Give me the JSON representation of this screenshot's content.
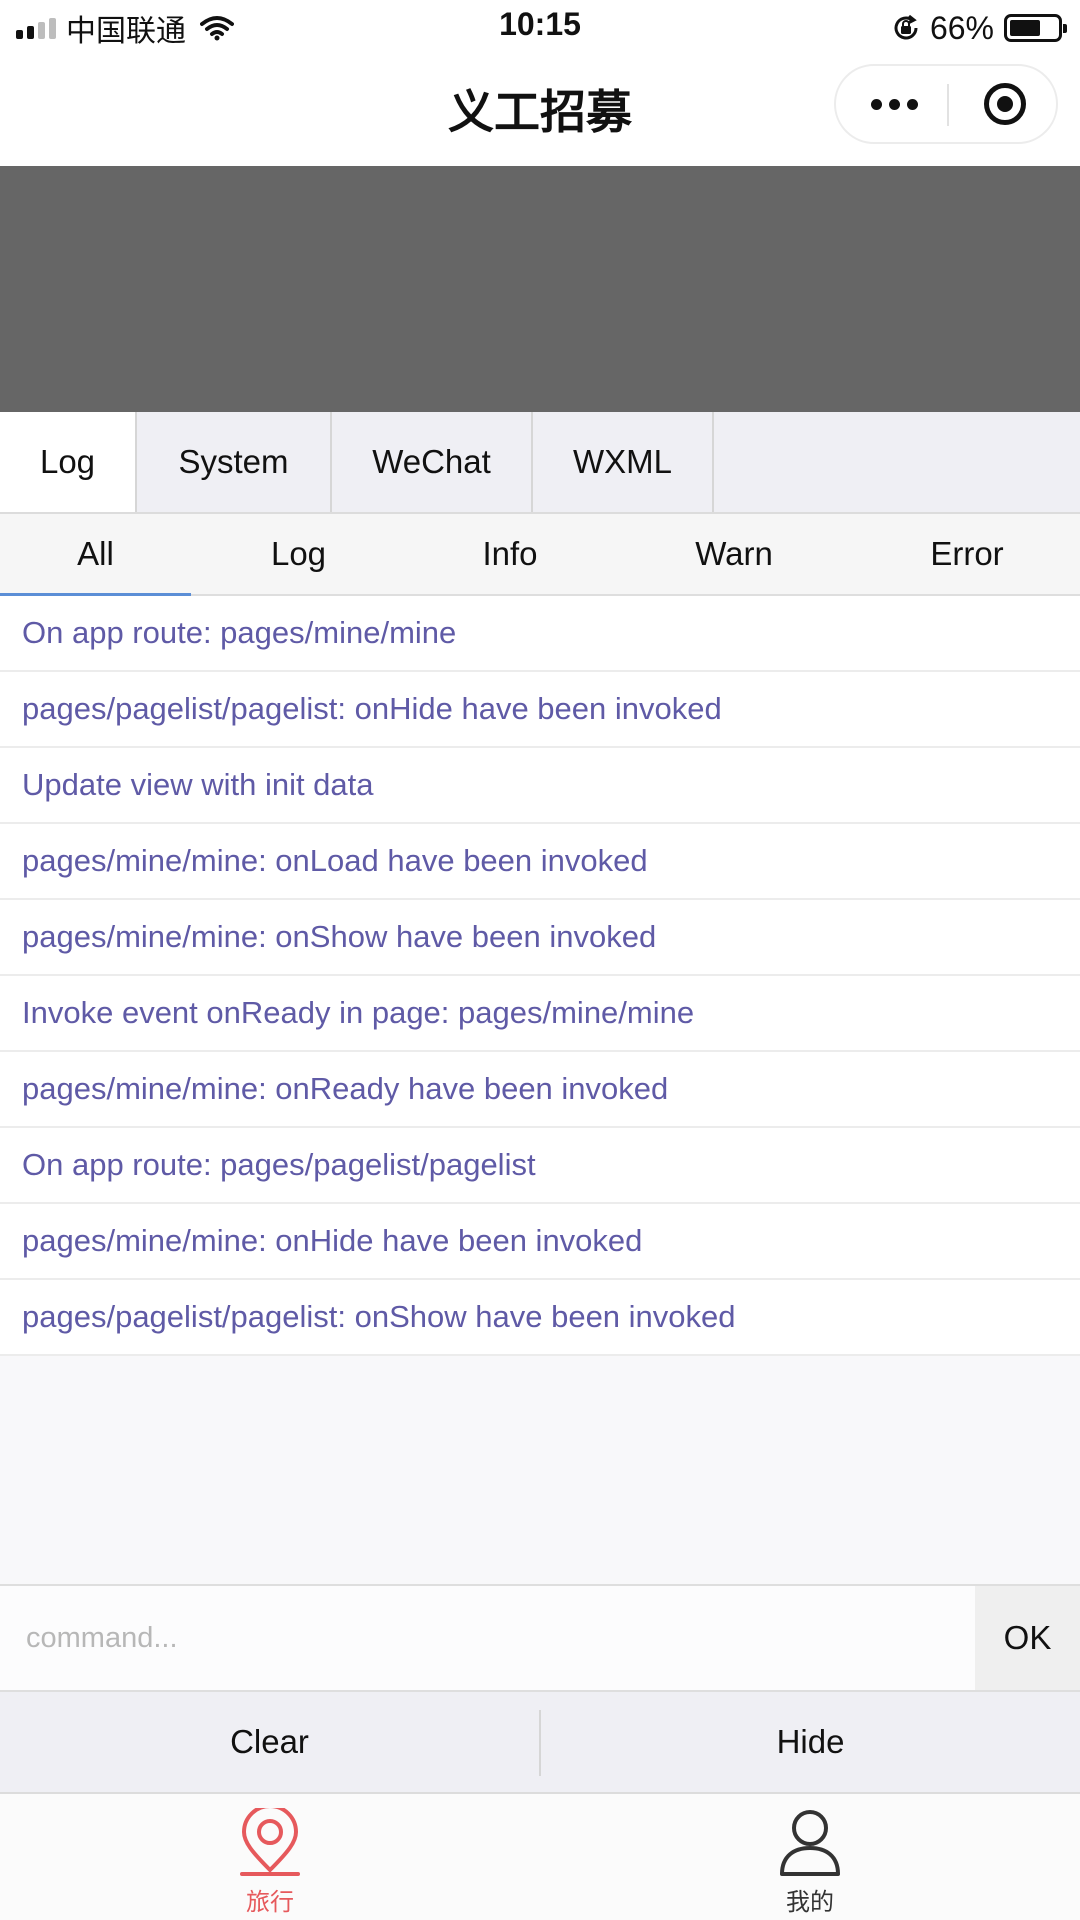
{
  "status_bar": {
    "carrier": "中国联通",
    "time": "10:15",
    "battery_percent": "66%",
    "battery_level": 0.66
  },
  "nav": {
    "title": "义工招募"
  },
  "console": {
    "tabs": [
      {
        "label": "Log",
        "active": true
      },
      {
        "label": "System",
        "active": false
      },
      {
        "label": "WeChat",
        "active": false
      },
      {
        "label": "WXML",
        "active": false
      }
    ],
    "filters": [
      {
        "label": "All",
        "active": true
      },
      {
        "label": "Log",
        "active": false
      },
      {
        "label": "Info",
        "active": false
      },
      {
        "label": "Warn",
        "active": false
      },
      {
        "label": "Error",
        "active": false
      }
    ],
    "logs": [
      "On app route: pages/mine/mine",
      "pages/pagelist/pagelist: onHide have been invoked",
      "Update view with init data",
      "pages/mine/mine: onLoad have been invoked",
      "pages/mine/mine: onShow have been invoked",
      "Invoke event onReady in page: pages/mine/mine",
      "pages/mine/mine: onReady have been invoked",
      "On app route: pages/pagelist/pagelist",
      "pages/mine/mine: onHide have been invoked",
      "pages/pagelist/pagelist: onShow have been invoked"
    ],
    "log_color": "#5f5aa6",
    "command": {
      "placeholder": "command...",
      "value": "",
      "ok_label": "OK"
    },
    "footer": {
      "clear_label": "Clear",
      "hide_label": "Hide"
    }
  },
  "tabbar": {
    "items": [
      {
        "label": "旅行",
        "icon": "location-pin-icon",
        "active": true
      },
      {
        "label": "我的",
        "icon": "person-icon",
        "active": false
      }
    ],
    "active_color": "#e6595c",
    "inactive_color": "#333333"
  }
}
